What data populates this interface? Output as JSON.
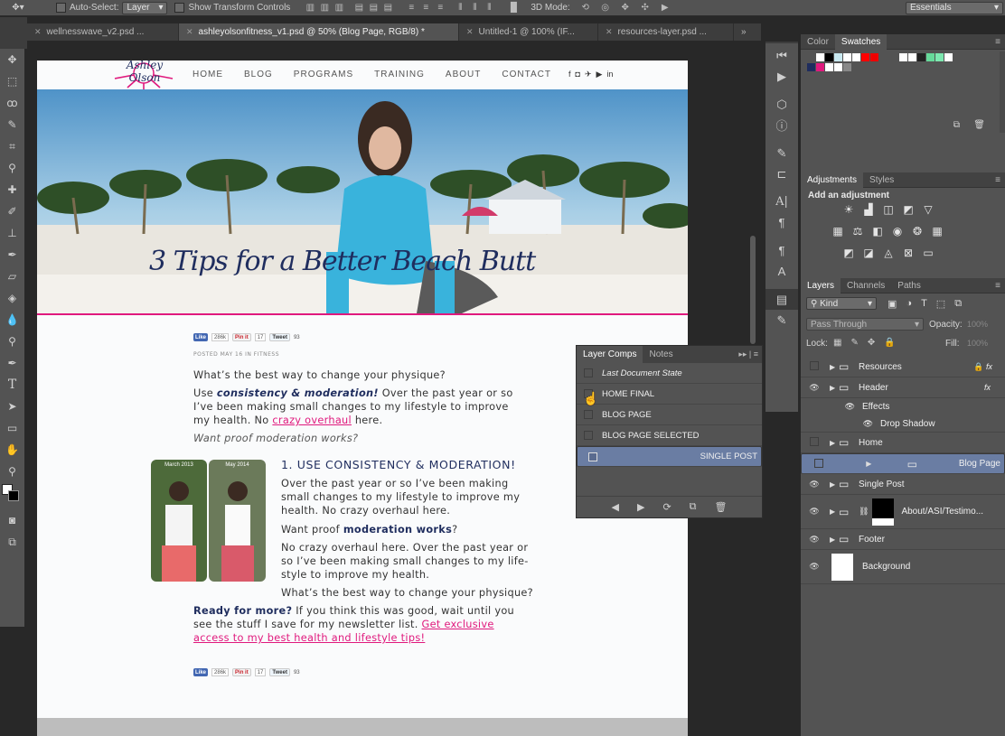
{
  "options_bar": {
    "auto_select_label": "Auto-Select:",
    "auto_select_value": "Layer",
    "show_transform_label": "Show Transform Controls",
    "mode_3d_label": "3D Mode:",
    "workspace_value": "Essentials"
  },
  "tabs": [
    {
      "label": "wellnesswave_v2.psd ..."
    },
    {
      "label": "ashleyolsonfitness_v1.psd @ 50% (Blog Page, RGB/8) *"
    },
    {
      "label": "Untitled-1 @ 100% (IF..."
    },
    {
      "label": "resources-layer.psd ..."
    }
  ],
  "doc": {
    "logo_text": "Ashley Olson",
    "nav": [
      "HOME",
      "BLOG",
      "PROGRAMS",
      "TRAINING",
      "ABOUT",
      "CONTACT"
    ],
    "hero_title": "3 Tips for a Better Beach Butt",
    "share_bar": {
      "like": "Like",
      "like_count": "286k",
      "pin": "Pin it",
      "pin_count": "17",
      "tweet": "Tweet",
      "tweet_count": "93"
    },
    "posted": "POSTED MAY 16 IN FITNESS",
    "q1": "What’s the best way to change your physique?",
    "p1_use": "Use ",
    "p1_em": "consistency & moderation!",
    "p1_rest": " Over the past year or so I’ve been making small changes to my lifestyle to improve my health. No ",
    "p1_link": "crazy overhaul",
    "p1_end": " here.",
    "q2": "Want proof moderation works?",
    "photo_left_label": "March 2013",
    "photo_right_label": "May 2014",
    "h1": "1. USE CONSISTENCY & MODERATION!",
    "p2": "Over the past year or so I’ve been making small changes to my lifestyle to improve my health. No crazy overhaul here.",
    "p3_pre": "Want proof ",
    "p3_bold": "moderation works",
    "p3_end": "?",
    "p4": "No crazy overhaul here. Over the past year or so I’ve been making small changes to my life-style to improve my health.",
    "p5": "What’s the best way to change your physique?",
    "p6_bold": "Ready for more?",
    "p6_rest": " If you think this was good, wait until you see the stuff I save for my newsletter list. ",
    "p6_link": "Get exclusive access to my best health and lifestyle tips!"
  },
  "swatches_panel": {
    "tab_color": "Color",
    "tab_swatches": "Swatches"
  },
  "adjustments_panel": {
    "tab_adjustments": "Adjustments",
    "tab_styles": "Styles",
    "heading": "Add an adjustment"
  },
  "layers_panel": {
    "tab_layers": "Layers",
    "tab_channels": "Channels",
    "tab_paths": "Paths",
    "kind": "Kind",
    "blend": "Pass Through",
    "opacity_label": "Opacity:",
    "opacity_value": "100%",
    "lock_label": "Lock:",
    "fill_label": "Fill:",
    "fill_value": "100%",
    "layers": [
      {
        "name": "Resources",
        "fx": "fx"
      },
      {
        "name": "Header",
        "fx": "fx"
      },
      {
        "name": "Effects"
      },
      {
        "name": "Drop Shadow"
      },
      {
        "name": "Home"
      },
      {
        "name": "Blog Page"
      },
      {
        "name": "Single Post"
      },
      {
        "name": "About/ASI/Testimo..."
      },
      {
        "name": "Footer"
      },
      {
        "name": "Background"
      }
    ]
  },
  "layer_comps": {
    "tab_comps": "Layer Comps",
    "tab_notes": "Notes",
    "items": [
      "Last Document State",
      "HOME FINAL",
      "BLOG PAGE",
      "BLOG PAGE SELECTED",
      "SINGLE POST"
    ]
  },
  "colors": {
    "accent": "#e0197d",
    "navy": "#1f2d5e",
    "selection": "#6a7da3"
  }
}
